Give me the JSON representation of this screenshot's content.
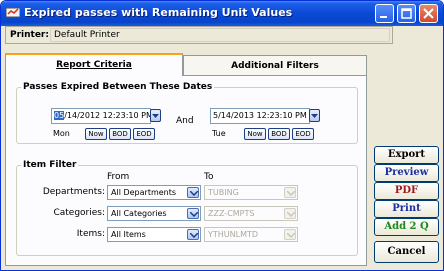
{
  "window": {
    "title": "Expired passes with Remaining Unit Values"
  },
  "printer": {
    "label": "Printer:",
    "value": "Default Printer"
  },
  "tabs": [
    {
      "label": "Report Criteria",
      "active": true
    },
    {
      "label": "Additional Filters",
      "active": false
    }
  ],
  "dates_group": {
    "legend": "Passes Expired Between These Dates",
    "start": {
      "month_part": "05",
      "rest": "/14/2012 12:23:10 PM",
      "day": "Mon"
    },
    "and_label": "And",
    "end": {
      "value": "5/14/2013 12:23:10 PM",
      "day": "Tue"
    },
    "now_label": "Now",
    "bod_label": "BOD",
    "eod_label": "EOD"
  },
  "item_filter": {
    "legend": "Item Filter",
    "from_label": "From",
    "to_label": "To",
    "rows": [
      {
        "label": "Departments:",
        "from": "All Departments",
        "to": "TUBING"
      },
      {
        "label": "Categories:",
        "from": "All Categories",
        "to": "ZZZ-CMPTS"
      },
      {
        "label": "Items:",
        "from": "All Items",
        "to": "YTHUNLMTD"
      }
    ]
  },
  "side_buttons": {
    "export": "Export",
    "preview": "Preview",
    "pdf": "PDF",
    "print": "Print",
    "add2q": "Add 2 Q",
    "cancel": "Cancel"
  },
  "colors": {
    "export": "#000000",
    "preview": "#1a2fa0",
    "pdf": "#a01818",
    "print": "#1a2fa0",
    "add2q": "#1a8a1a",
    "cancel": "#000000",
    "title_bar": "#0a49d6",
    "tab_accent": "#f7a21b"
  }
}
